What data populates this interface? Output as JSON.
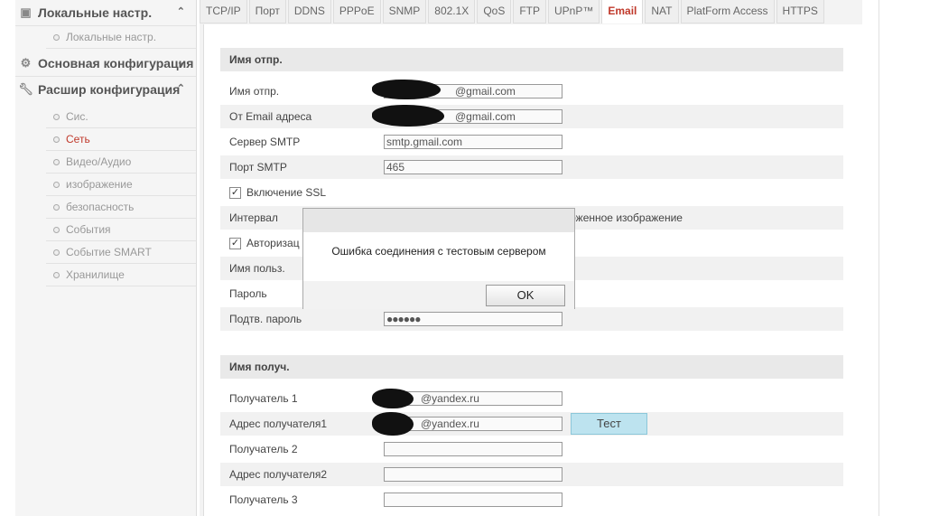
{
  "sidebar": {
    "local": {
      "title": "Локальные настр.",
      "sub": "Локальные настр."
    },
    "basic": {
      "title": "Основная конфигурация"
    },
    "advanced": {
      "title": "Расшир конфигурация",
      "items": [
        "Сис.",
        "Сеть",
        "Видео/Аудио",
        "изображение",
        "безопасность",
        "События",
        "Событие SMART",
        "Хранилище"
      ],
      "active_index": 1
    }
  },
  "tabs": [
    "TCP/IP",
    "Порт",
    "DDNS",
    "PPPoE",
    "SNMP",
    "802.1X",
    "QoS",
    "FTP",
    "UPnP™",
    "Email",
    "NAT",
    "PlatForm Access",
    "HTTPS"
  ],
  "active_tab": "Email",
  "sender": {
    "header": "Имя отпр.",
    "name_label": "Имя отпр.",
    "name_value": "@gmail.com",
    "email_label": "От Email адреса",
    "email_value": "@gmail.com",
    "smtp_label": "Сервер SMTP",
    "smtp_value": "smtp.gmail.com",
    "port_label": "Порт SMTP",
    "port_value": "465",
    "ssl_label": "Включение SSL",
    "ssl_checked": true,
    "interval_label": "Интервал",
    "attach_label": "ложенное изображение",
    "auth_label": "Авторизац",
    "auth_checked": true,
    "user_label": "Имя польз.",
    "password_label": "Пароль",
    "confirm_label": "Подтв. пароль",
    "confirm_value": "●●●●●●"
  },
  "receiver": {
    "header": "Имя получ.",
    "r1_label": "Получатель 1",
    "r1_value": "@yandex.ru",
    "a1_label": "Адрес получателя1",
    "a1_value": "@yandex.ru",
    "test_label": "Тест",
    "r2_label": "Получатель 2",
    "a2_label": "Адрес получателя2",
    "r3_label": "Получатель 3"
  },
  "dialog": {
    "message": "Ошибка соединения с тестовым сервером",
    "ok_label": "OK"
  }
}
